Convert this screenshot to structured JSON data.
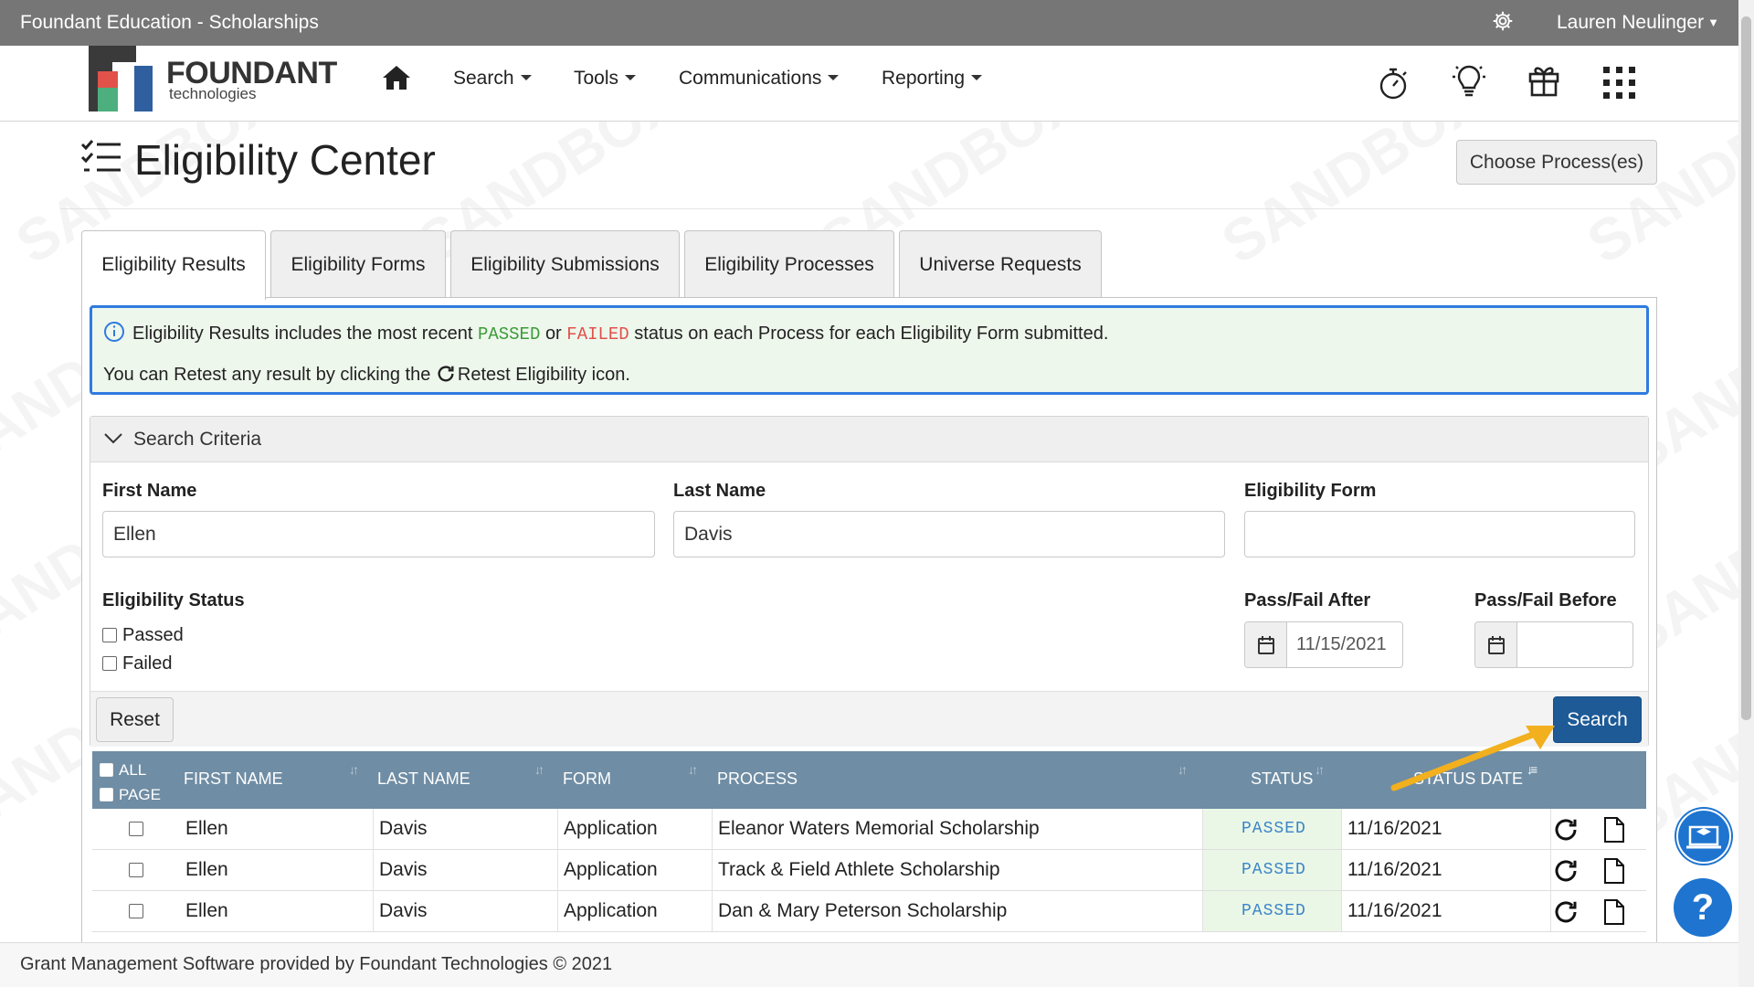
{
  "app": {
    "title": "Foundant Education - Scholarships",
    "user": "Lauren Neulinger"
  },
  "logo": {
    "word1": "FOUNDANT",
    "word2": "technologies"
  },
  "nav": {
    "items": [
      "Search",
      "Tools",
      "Communications",
      "Reporting"
    ]
  },
  "page": {
    "title": "Eligibility Center",
    "choose_button": "Choose Process(es)",
    "watermark": "SANDBOX"
  },
  "tabs": [
    "Eligibility Results",
    "Eligibility Forms",
    "Eligibility Submissions",
    "Eligibility Processes",
    "Universe Requests"
  ],
  "info": {
    "l1_a": "Eligibility Results includes the most recent",
    "passed": "PASSED",
    "or": "or",
    "failed": "FAILED",
    "l1_b": "status on each Process for each Eligibility Form submitted.",
    "l2_a": "You can Retest any result by clicking the",
    "l2_b": "Retest Eligibility icon."
  },
  "search": {
    "header": "Search Criteria",
    "first_name_label": "First Name",
    "first_name": "Ellen",
    "last_name_label": "Last Name",
    "last_name": "Davis",
    "form_label": "Eligibility Form",
    "form": "",
    "status_label": "Eligibility Status",
    "status_options": [
      "Passed",
      "Failed"
    ],
    "after_label": "Pass/Fail After",
    "after": "11/15/2021",
    "before_label": "Pass/Fail Before",
    "before": "",
    "reset": "Reset",
    "search": "Search"
  },
  "table": {
    "select_all": "ALL",
    "select_page": "PAGE",
    "columns": [
      "FIRST NAME",
      "LAST NAME",
      "FORM",
      "PROCESS",
      "STATUS",
      "STATUS DATE"
    ],
    "rows": [
      {
        "first": "Ellen",
        "last": "Davis",
        "form": "Application",
        "process": "Eleanor Waters Memorial Scholarship",
        "status": "PASSED",
        "date": "11/16/2021"
      },
      {
        "first": "Ellen",
        "last": "Davis",
        "form": "Application",
        "process": "Track & Field Athlete Scholarship",
        "status": "PASSED",
        "date": "11/16/2021"
      },
      {
        "first": "Ellen",
        "last": "Davis",
        "form": "Application",
        "process": "Dan & Mary Peterson Scholarship",
        "status": "PASSED",
        "date": "11/16/2021"
      }
    ]
  },
  "footer": "Grant Management Software provided by Foundant Technologies © 2021",
  "colors": {
    "topbar": "#767676",
    "table_header": "#6f8da4",
    "primary_button": "#1d5a96",
    "info_border": "#2f7be0",
    "passed": "#3c9b39",
    "failed": "#e0524a",
    "help_button": "#1e74cf"
  }
}
